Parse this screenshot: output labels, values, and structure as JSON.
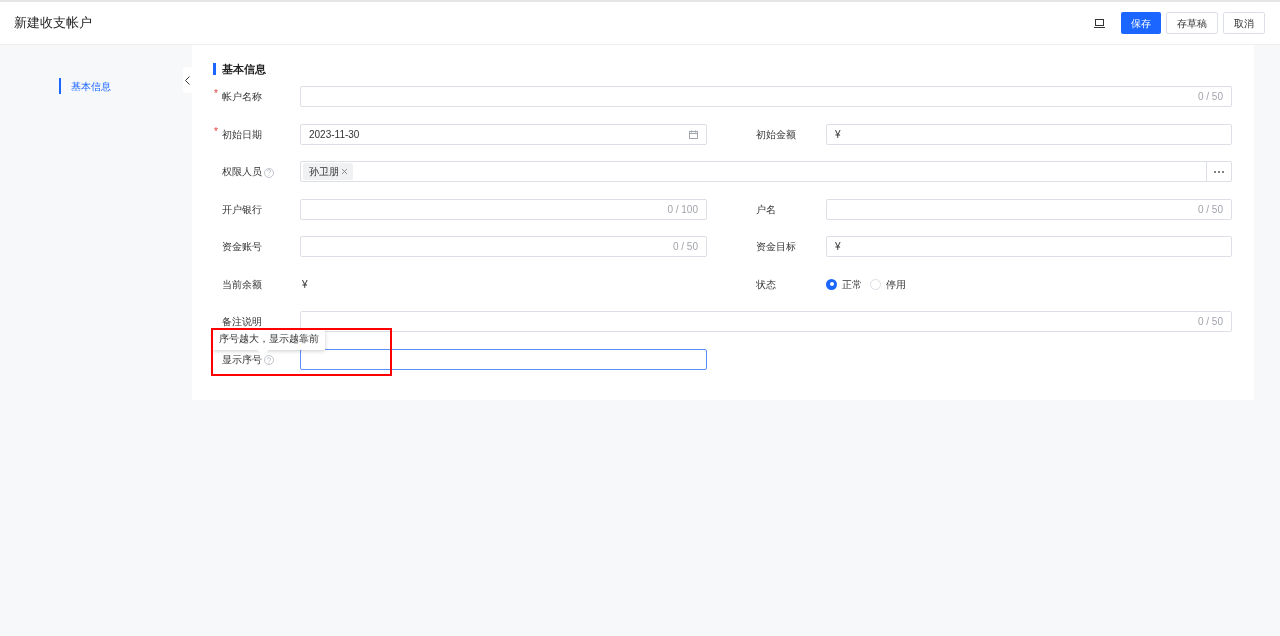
{
  "header": {
    "title": "新建收支帐户",
    "buttons": [
      {
        "label": "保存",
        "kind": "primary"
      },
      {
        "label": "存草稿",
        "kind": "default"
      },
      {
        "label": "取消",
        "kind": "default"
      }
    ]
  },
  "sidebar": {
    "items": [
      {
        "label": "基本信息",
        "selected": true
      }
    ]
  },
  "section": {
    "title": "基本信息"
  },
  "rows": [
    [
      {
        "label": "帐户名称",
        "required_mark": "*",
        "kind": "text",
        "wide": true,
        "counter": "0 / 50"
      }
    ],
    [
      {
        "label": "初始日期",
        "required_mark": "*",
        "kind": "date",
        "value": "2023-11-30"
      },
      {
        "label": "初始金额",
        "kind": "amount",
        "prefix": "¥"
      }
    ],
    [
      {
        "label": "权限人员",
        "help": true,
        "kind": "people",
        "wide": true,
        "tags": [
          "孙卫朋"
        ],
        "more": "⋯"
      }
    ],
    [
      {
        "label": "开户银行",
        "kind": "text",
        "counter": "0 / 100"
      },
      {
        "label": "户名",
        "kind": "text",
        "counter": "0 / 50"
      }
    ],
    [
      {
        "label": "资金账号",
        "kind": "text",
        "counter": "0 / 50"
      },
      {
        "label": "资金目标",
        "kind": "amount",
        "prefix": "¥"
      }
    ],
    [
      {
        "label": "当前余额",
        "kind": "readonly",
        "value": "¥"
      },
      {
        "label": "状态",
        "kind": "radio",
        "options": [
          {
            "label": "正常",
            "selected": true
          },
          {
            "label": "停用",
            "selected": false
          }
        ]
      }
    ],
    [
      {
        "label": "备注说明",
        "kind": "text",
        "wide": true,
        "counter": "0 / 50"
      }
    ],
    [
      {
        "label": "显示序号",
        "help": true,
        "kind": "text",
        "focused": true,
        "tooltip": "序号越大，显示越靠前",
        "highlight": true
      }
    ]
  ]
}
